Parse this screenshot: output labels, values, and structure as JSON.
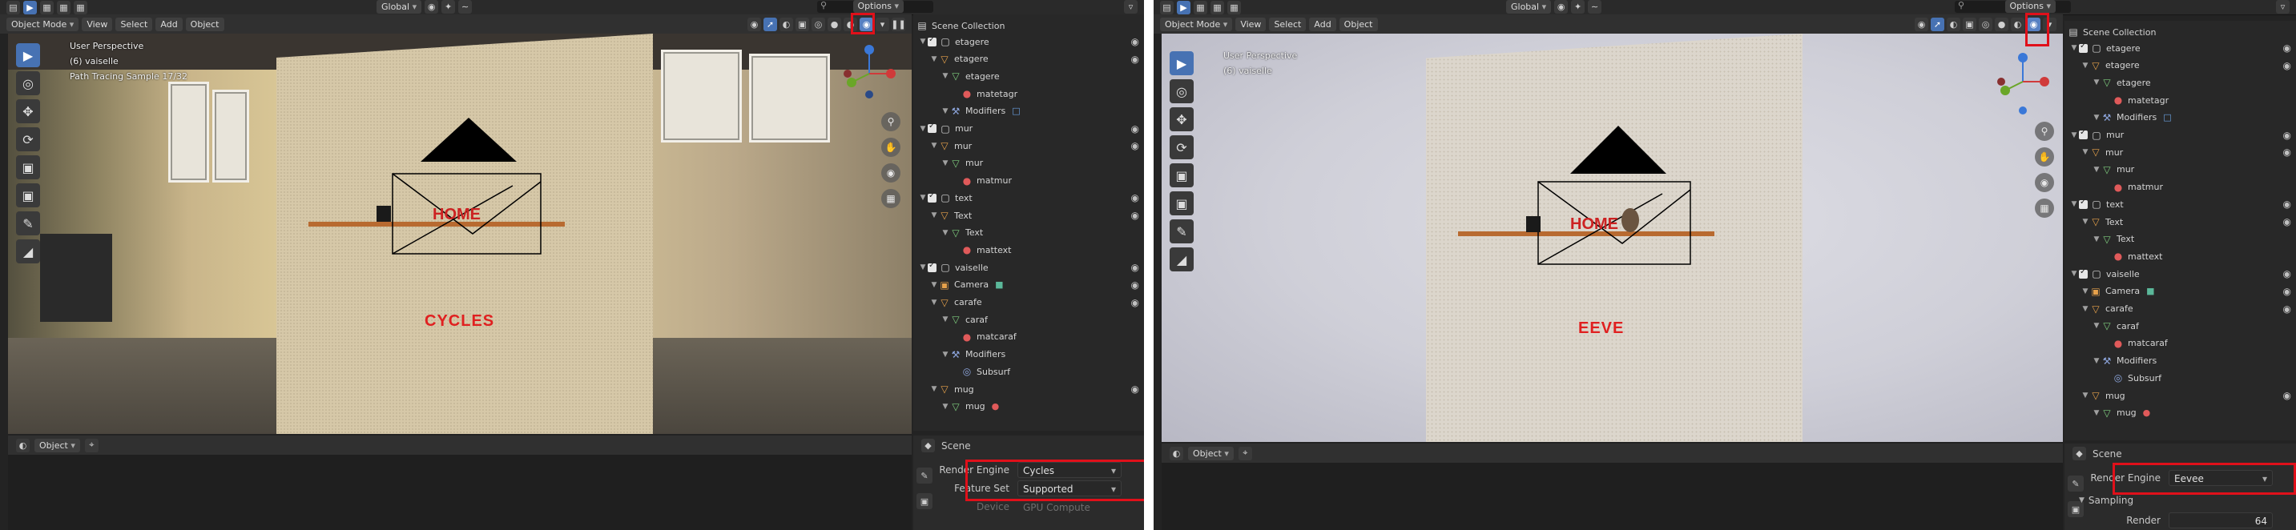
{
  "colors": {
    "highlight_box": "#e0101a",
    "label_red": "#e02020",
    "active_blue": "#4772b3"
  },
  "left": {
    "header": {
      "options_label": "Options",
      "mode_label": "Object Mode",
      "menu": [
        "View",
        "Select",
        "Add",
        "Object"
      ],
      "transform_label": "Global"
    },
    "viewport": {
      "overlay": [
        "User Perspective",
        "(6) vaiselle",
        "Path Tracing Sample 17/32"
      ],
      "engine_label": "CYCLES",
      "sign_text": "HOME"
    },
    "timeline": {
      "object_label": "Object"
    },
    "properties": {
      "scene_label": "Scene",
      "render_engine_label": "Render Engine",
      "render_engine_value": "Cycles",
      "feature_set_label": "Feature Set",
      "feature_set_value": "Supported",
      "device_label": "Device",
      "device_value": "GPU Compute"
    }
  },
  "right": {
    "header": {
      "options_label": "Options",
      "mode_label": "Object Mode",
      "menu": [
        "View",
        "Select",
        "Add",
        "Object"
      ],
      "transform_label": "Global"
    },
    "viewport": {
      "overlay": [
        "User Perspective",
        "(6) vaiselle"
      ],
      "engine_label": "EEVE",
      "sign_text": "HOME"
    },
    "timeline": {
      "object_label": "Object"
    },
    "properties": {
      "scene_label": "Scene",
      "render_engine_label": "Render Engine",
      "render_engine_value": "Eevee",
      "sampling_label": "Sampling",
      "render_label": "Render",
      "render_value": "64"
    }
  },
  "outliner": {
    "root": "Scene Collection",
    "rows": [
      {
        "label": "etagere",
        "icon": "collection-icon",
        "depth": 0,
        "check": true,
        "eye": true
      },
      {
        "label": "etagere",
        "icon": "object-icon",
        "depth": 1,
        "eye": true
      },
      {
        "label": "etagere",
        "icon": "mesh-data-icon",
        "depth": 2
      },
      {
        "label": "matetagr",
        "icon": "material-icon",
        "depth": 3
      },
      {
        "label": "Modifiers",
        "icon": "wrench-icon",
        "depth": 2,
        "extra": "modifier-icon"
      },
      {
        "label": "mur",
        "icon": "collection-icon",
        "depth": 0,
        "check": true,
        "eye": true
      },
      {
        "label": "mur",
        "icon": "object-icon",
        "depth": 1,
        "eye": true
      },
      {
        "label": "mur",
        "icon": "mesh-data-icon",
        "depth": 2
      },
      {
        "label": "matmur",
        "icon": "material-icon",
        "depth": 3
      },
      {
        "label": "text",
        "icon": "collection-icon",
        "depth": 0,
        "check": true,
        "eye": true
      },
      {
        "label": "Text",
        "icon": "object-icon",
        "depth": 1,
        "eye": true
      },
      {
        "label": "Text",
        "icon": "text-data-icon",
        "depth": 2
      },
      {
        "label": "mattext",
        "icon": "material-icon",
        "depth": 3
      },
      {
        "label": "vaiselle",
        "icon": "collection-icon",
        "depth": 0,
        "check": true,
        "eye": true
      },
      {
        "label": "Camera",
        "icon": "camera-icon",
        "depth": 1,
        "eye": true,
        "extra": "camera-data-icon"
      },
      {
        "label": "carafe",
        "icon": "object-icon",
        "depth": 1,
        "eye": true
      },
      {
        "label": "caraf",
        "icon": "mesh-data-icon",
        "depth": 2
      },
      {
        "label": "matcaraf",
        "icon": "material-icon",
        "depth": 3
      },
      {
        "label": "Modifiers",
        "icon": "wrench-icon",
        "depth": 2
      },
      {
        "label": "Subsurf",
        "icon": "subsurf-icon",
        "depth": 3
      },
      {
        "label": "mug",
        "icon": "object-icon",
        "depth": 1,
        "eye": true
      },
      {
        "label": "mug",
        "icon": "mesh-data-icon",
        "depth": 2,
        "extra": "material-icon"
      }
    ]
  }
}
